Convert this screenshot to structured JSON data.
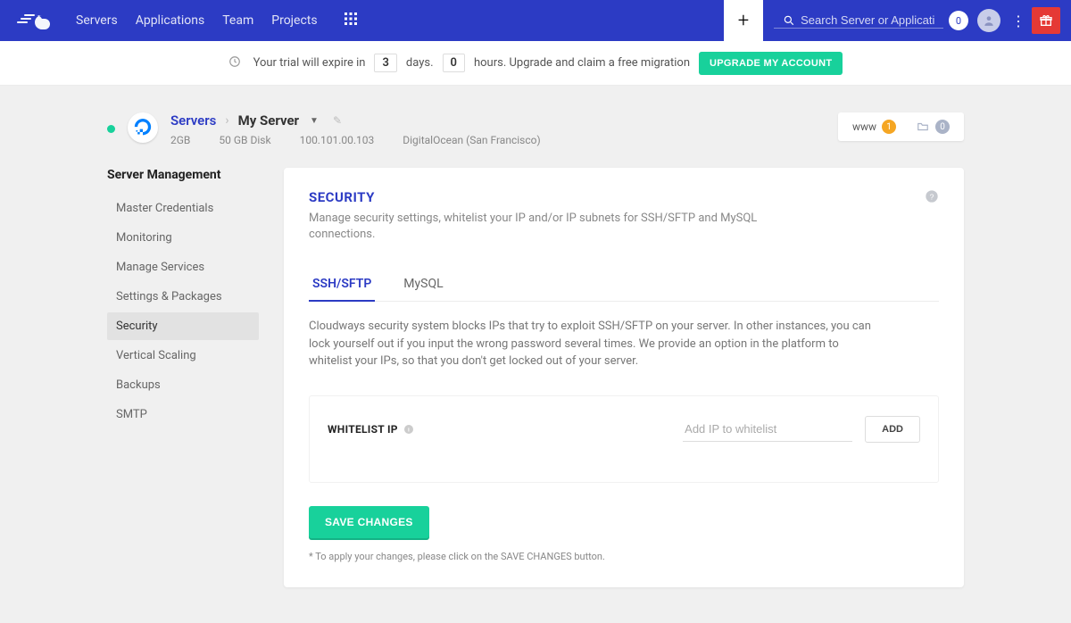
{
  "nav": {
    "links": [
      "Servers",
      "Applications",
      "Team",
      "Projects"
    ],
    "search_placeholder": "Search Server or Application",
    "notif_count": "0"
  },
  "trial": {
    "prefix": "Your trial will expire in",
    "days_val": "3",
    "days_label": "days.",
    "hours_val": "0",
    "hours_label": "hours. Upgrade and claim a free migration",
    "upgrade_label": "UPGRADE MY ACCOUNT"
  },
  "server": {
    "breadcrumb_root": "Servers",
    "name": "My Server",
    "ram": "2GB",
    "disk": "50 GB Disk",
    "ip": "100.101.00.103",
    "provider": "DigitalOcean (San Francisco)",
    "apps_www_label": "www",
    "apps_www_count": "1",
    "apps_folder_count": "0"
  },
  "sidebar": {
    "title": "Server Management",
    "items": [
      {
        "label": "Master Credentials"
      },
      {
        "label": "Monitoring"
      },
      {
        "label": "Manage Services"
      },
      {
        "label": "Settings & Packages"
      },
      {
        "label": "Security"
      },
      {
        "label": "Vertical Scaling"
      },
      {
        "label": "Backups"
      },
      {
        "label": "SMTP"
      }
    ]
  },
  "main": {
    "title": "SECURITY",
    "subtitle": "Manage security settings, whitelist your IP and/or IP subnets for SSH/SFTP and MySQL connections.",
    "tabs": [
      "SSH/SFTP",
      "MySQL"
    ],
    "tab_desc": "Cloudways security system blocks IPs that try to exploit SSH/SFTP on your server. In other instances, you can lock yourself out if you input the wrong password several times. We provide an option in the platform to whitelist your IPs, so that you don't get locked out of your server.",
    "whitelist_label": "WHITELIST IP",
    "whitelist_placeholder": "Add IP to whitelist",
    "add_label": "ADD",
    "save_label": "SAVE CHANGES",
    "note": "* To apply your changes, please click on the SAVE CHANGES button."
  }
}
